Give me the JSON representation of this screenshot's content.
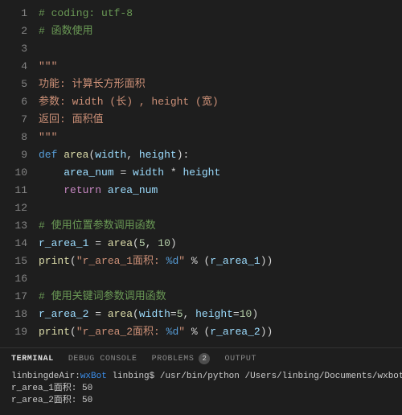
{
  "editor": {
    "lineNumbers": [
      "1",
      "2",
      "3",
      "4",
      "5",
      "6",
      "7",
      "8",
      "9",
      "10",
      "11",
      "12",
      "13",
      "14",
      "15",
      "16",
      "17",
      "18",
      "19"
    ],
    "lines": [
      [
        {
          "t": "comment",
          "v": "# coding: utf-8"
        }
      ],
      [
        {
          "t": "comment",
          "v": "# 函数使用"
        }
      ],
      [],
      [
        {
          "t": "string",
          "v": "\"\"\""
        }
      ],
      [
        {
          "t": "string",
          "v": "功能: 计算长方形面积"
        }
      ],
      [
        {
          "t": "string",
          "v": "参数: width (长) , height (宽)"
        }
      ],
      [
        {
          "t": "string",
          "v": "返回: 面积值"
        }
      ],
      [
        {
          "t": "string",
          "v": "\"\"\""
        }
      ],
      [
        {
          "t": "keyword",
          "v": "def "
        },
        {
          "t": "func",
          "v": "area"
        },
        {
          "t": "punc",
          "v": "("
        },
        {
          "t": "param",
          "v": "width"
        },
        {
          "t": "punc",
          "v": ", "
        },
        {
          "t": "param",
          "v": "height"
        },
        {
          "t": "punc",
          "v": "):"
        }
      ],
      [
        {
          "t": "plain",
          "v": "    "
        },
        {
          "t": "var",
          "v": "area_num"
        },
        {
          "t": "op",
          "v": " = "
        },
        {
          "t": "var",
          "v": "width"
        },
        {
          "t": "op",
          "v": " * "
        },
        {
          "t": "var",
          "v": "height"
        }
      ],
      [
        {
          "t": "plain",
          "v": "    "
        },
        {
          "t": "keyword2",
          "v": "return"
        },
        {
          "t": "plain",
          "v": " "
        },
        {
          "t": "var",
          "v": "area_num"
        }
      ],
      [],
      [
        {
          "t": "comment",
          "v": "# 使用位置参数调用函数"
        }
      ],
      [
        {
          "t": "var",
          "v": "r_area_1"
        },
        {
          "t": "op",
          "v": " = "
        },
        {
          "t": "func",
          "v": "area"
        },
        {
          "t": "punc",
          "v": "("
        },
        {
          "t": "num",
          "v": "5"
        },
        {
          "t": "punc",
          "v": ", "
        },
        {
          "t": "num",
          "v": "10"
        },
        {
          "t": "punc",
          "v": ")"
        }
      ],
      [
        {
          "t": "func",
          "v": "print"
        },
        {
          "t": "punc",
          "v": "("
        },
        {
          "t": "string",
          "v": "\"r_area_1面积: "
        },
        {
          "t": "fmt",
          "v": "%d"
        },
        {
          "t": "string",
          "v": "\""
        },
        {
          "t": "op",
          "v": " % "
        },
        {
          "t": "punc",
          "v": "("
        },
        {
          "t": "var",
          "v": "r_area_1"
        },
        {
          "t": "punc",
          "v": "))"
        }
      ],
      [],
      [
        {
          "t": "comment",
          "v": "# 使用关键词参数调用函数"
        }
      ],
      [
        {
          "t": "var",
          "v": "r_area_2"
        },
        {
          "t": "op",
          "v": " = "
        },
        {
          "t": "func",
          "v": "area"
        },
        {
          "t": "punc",
          "v": "("
        },
        {
          "t": "param",
          "v": "width"
        },
        {
          "t": "op",
          "v": "="
        },
        {
          "t": "num",
          "v": "5"
        },
        {
          "t": "punc",
          "v": ", "
        },
        {
          "t": "param",
          "v": "height"
        },
        {
          "t": "op",
          "v": "="
        },
        {
          "t": "num",
          "v": "10"
        },
        {
          "t": "punc",
          "v": ")"
        }
      ],
      [
        {
          "t": "func",
          "v": "print"
        },
        {
          "t": "punc",
          "v": "("
        },
        {
          "t": "string",
          "v": "\"r_area_2面积: "
        },
        {
          "t": "fmt",
          "v": "%d"
        },
        {
          "t": "string",
          "v": "\""
        },
        {
          "t": "op",
          "v": " % "
        },
        {
          "t": "punc",
          "v": "("
        },
        {
          "t": "var",
          "v": "r_area_2"
        },
        {
          "t": "punc",
          "v": "))"
        }
      ]
    ]
  },
  "panel": {
    "tabs": {
      "terminal": "TERMINAL",
      "debug": "DEBUG CONSOLE",
      "problems": "PROBLEMS",
      "problemsCount": "2",
      "output": "OUTPUT"
    },
    "terminal": {
      "promptHost": "linbingdeAir:",
      "promptDir": "wxBot",
      "promptUser": " linbing$ ",
      "cmd": "/usr/bin/python /Users/linbing/Documents/wxbot",
      "out1": "r_area_1面积: 50",
      "out2": "r_area_2面积: 50"
    }
  }
}
